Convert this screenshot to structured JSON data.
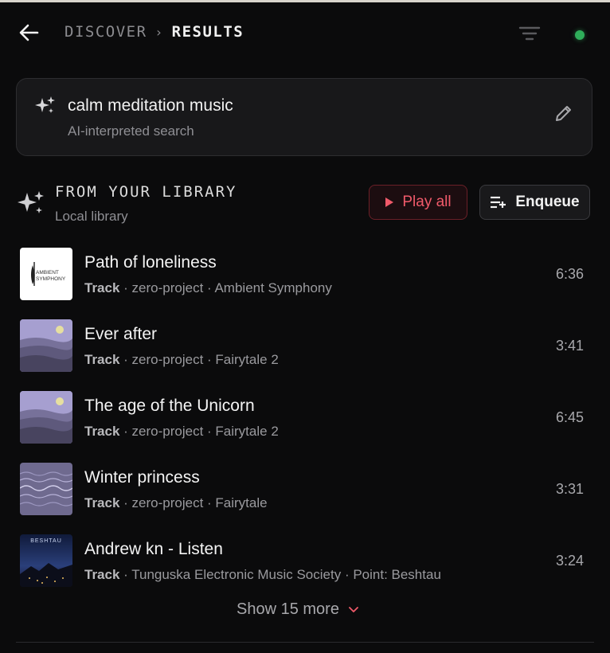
{
  "header": {
    "breadcrumb_parent": "DISCOVER",
    "breadcrumb_separator": "›",
    "breadcrumb_current": "RESULTS",
    "status_color": "#2fae5a"
  },
  "search": {
    "query": "calm meditation music",
    "subtitle": "AI-interpreted search"
  },
  "section": {
    "title": "FROM YOUR LIBRARY",
    "subtitle": "Local library",
    "play_all_label": "Play all",
    "enqueue_label": "Enqueue",
    "accent_color": "#f05a6a"
  },
  "tracks": [
    {
      "title": "Path of loneliness",
      "kind": "Track",
      "meta": " · zero-project · Ambient Symphony",
      "duration": "6:36",
      "art": "ambient-symphony-cover",
      "art_text_1": "AMBIENT",
      "art_text_2": "SYMPHONY"
    },
    {
      "title": "Ever after",
      "kind": "Track",
      "meta": " · zero-project · Fairytale 2",
      "duration": "3:41",
      "art": "fairytale-2-cover"
    },
    {
      "title": "The age of the Unicorn",
      "kind": "Track",
      "meta": " · zero-project · Fairytale 2",
      "duration": "6:45",
      "art": "fairytale-2-cover"
    },
    {
      "title": "Winter princess",
      "kind": "Track",
      "meta": " · zero-project · Fairytale",
      "duration": "3:31",
      "art": "fairytale-cover"
    },
    {
      "title": "Andrew kn - Listen",
      "kind": "Track",
      "meta": " · Tunguska Electronic Music Society · Point: Beshtau",
      "duration": "3:24",
      "art": "beshtau-cover",
      "art_text_1": "BESHTAU"
    }
  ],
  "show_more_label": "Show 15 more",
  "icons": {
    "back": "arrow-left-icon",
    "filter": "filter-icon",
    "sparkle": "sparkle-icon",
    "edit": "pencil-icon",
    "play": "play-icon",
    "enqueue": "queue-add-icon",
    "chevron": "chevron-down-icon"
  }
}
